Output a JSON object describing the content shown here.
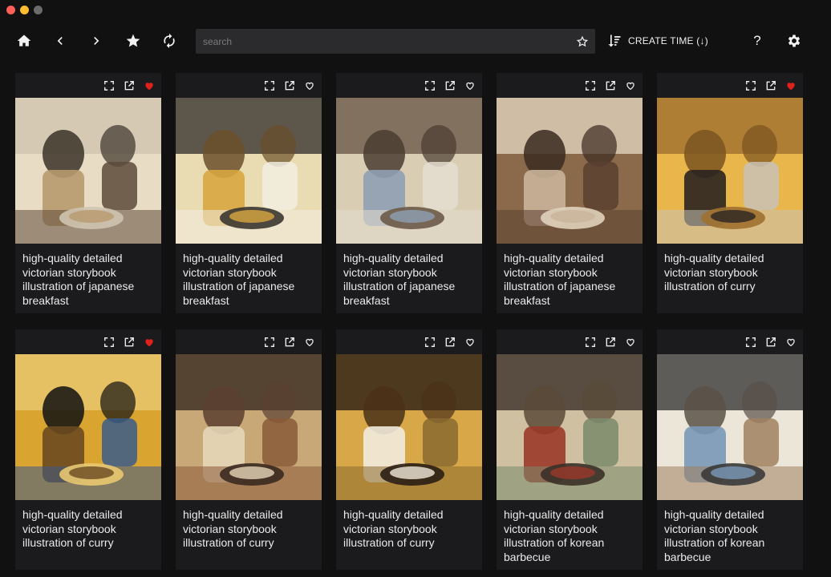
{
  "toolbar": {
    "home_icon": "home-icon",
    "back_icon": "chevron-left-icon",
    "forward_icon": "chevron-right-icon",
    "favorites_icon": "star-icon",
    "refresh_icon": "refresh-icon",
    "search_placeholder": "search",
    "search_value": "",
    "sort_label": "CREATE TIME (↓)",
    "help_label": "?",
    "settings_icon": "gear-icon"
  },
  "colors": {
    "background": "#111112",
    "card": "#1b1b1d",
    "search": "#2b2b2d",
    "favorite_red": "#e0211b",
    "text": "#eaeaea"
  },
  "cards": [
    {
      "caption": "high-quality detailed victorian storybook illustration of japanese breakfast",
      "favorited": true,
      "palette": [
        "#e8dcc4",
        "#3b3228",
        "#b89a6e",
        "#5c4a3a",
        "#cfc4b0"
      ]
    },
    {
      "caption": "high-quality detailed victorian storybook illustration of japanese breakfast",
      "favorited": false,
      "palette": [
        "#e9dcb3",
        "#6b4f2a",
        "#d8a640",
        "#f2ede0",
        "#3a3530"
      ]
    },
    {
      "caption": "high-quality detailed victorian storybook illustration of japanese breakfast",
      "favorited": false,
      "palette": [
        "#d9cdb4",
        "#4a3c30",
        "#8fa0b4",
        "#e4ddd0",
        "#6b5a48"
      ]
    },
    {
      "caption": "high-quality detailed victorian storybook illustration of japanese breakfast",
      "favorited": false,
      "palette": [
        "#8a6a4a",
        "#3a2a20",
        "#c9b49a",
        "#5b4030",
        "#e0d2bc"
      ]
    },
    {
      "caption": "high-quality detailed victorian storybook illustration of curry",
      "favorited": true,
      "palette": [
        "#e8b64a",
        "#7a5320",
        "#2a2420",
        "#c9c2b6",
        "#a07030"
      ]
    },
    {
      "caption": "high-quality detailed victorian storybook illustration of curry",
      "favorited": true,
      "palette": [
        "#d9a530",
        "#111111",
        "#6a4a20",
        "#3a5a8a",
        "#e8c870"
      ]
    },
    {
      "caption": "high-quality detailed victorian storybook illustration of curry",
      "favorited": false,
      "palette": [
        "#c9a878",
        "#5a4030",
        "#e6d6b8",
        "#8a5a38",
        "#3a2a20"
      ]
    },
    {
      "caption": "high-quality detailed victorian storybook illustration of curry",
      "favorited": false,
      "palette": [
        "#d8a848",
        "#4a3018",
        "#f2eadc",
        "#8a6a30",
        "#2a1e14"
      ]
    },
    {
      "caption": "high-quality detailed victorian storybook illustration of korean barbecue",
      "favorited": false,
      "palette": [
        "#cfc0a2",
        "#5a4a38",
        "#9a3a2a",
        "#7a8a6a",
        "#3a3028"
      ]
    },
    {
      "caption": "high-quality detailed victorian storybook illustration of korean barbecue",
      "favorited": false,
      "palette": [
        "#ece6d8",
        "#5a5048",
        "#7a98b8",
        "#a08060",
        "#3a3a3a"
      ]
    }
  ]
}
